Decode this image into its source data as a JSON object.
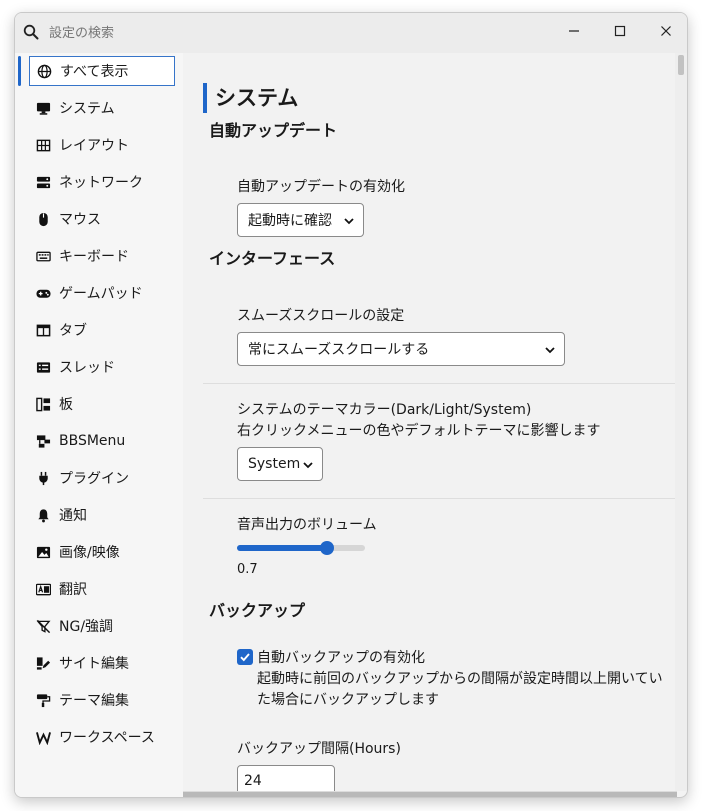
{
  "search": {
    "placeholder": "設定の検索"
  },
  "sidebar": {
    "items": [
      {
        "label": "すべて表示",
        "icon": "globe-icon",
        "selected": true
      },
      {
        "label": "システム",
        "icon": "monitor-icon"
      },
      {
        "label": "レイアウト",
        "icon": "grid-icon"
      },
      {
        "label": "ネットワーク",
        "icon": "server-icon"
      },
      {
        "label": "マウス",
        "icon": "mouse-icon"
      },
      {
        "label": "キーボード",
        "icon": "keyboard-icon"
      },
      {
        "label": "ゲームパッド",
        "icon": "gamepad-icon"
      },
      {
        "label": "タブ",
        "icon": "tab-icon"
      },
      {
        "label": "スレッド",
        "icon": "list-icon"
      },
      {
        "label": "板",
        "icon": "board-icon"
      },
      {
        "label": "BBSMenu",
        "icon": "sitemap-icon"
      },
      {
        "label": "プラグイン",
        "icon": "plug-icon"
      },
      {
        "label": "通知",
        "icon": "bell-icon"
      },
      {
        "label": "画像/映像",
        "icon": "image-icon"
      },
      {
        "label": "翻訳",
        "icon": "translate-icon"
      },
      {
        "label": "NG/強調",
        "icon": "filter-off-icon"
      },
      {
        "label": "サイト編集",
        "icon": "site-edit-icon"
      },
      {
        "label": "テーマ編集",
        "icon": "paint-roller-icon"
      },
      {
        "label": "ワークスペース",
        "icon": "workspace-w-icon"
      }
    ]
  },
  "main": {
    "title": "システム",
    "auto_update": {
      "heading": "自動アップデート",
      "label": "自動アップデートの有効化",
      "value": "起動時に確認"
    },
    "interface": {
      "heading": "インターフェース",
      "smooth_label": "スムーズスクロールの設定",
      "smooth_value": "常にスムーズスクロールする",
      "theme_label": "システムのテーマカラー(Dark/Light/System)",
      "theme_desc": "右クリックメニューの色やデフォルトテーマに影響します",
      "theme_value": "System",
      "volume_label": "音声出力のボリューム",
      "volume_value": "0.7",
      "volume_fraction": 0.7
    },
    "backup": {
      "heading": "バックアップ",
      "auto_label": "自動バックアップの有効化",
      "auto_checked": true,
      "desc_line1": "起動時に前回のバックアップからの間隔が設定時間以上開いてい",
      "desc_line2": "た場合にバックアップします",
      "interval_label": "バックアップ間隔(Hours)",
      "interval_value": "24"
    }
  },
  "colors": {
    "accent": "#1f66c9",
    "background": "#f2f2f2",
    "sidebar": "#f6f6f6"
  }
}
